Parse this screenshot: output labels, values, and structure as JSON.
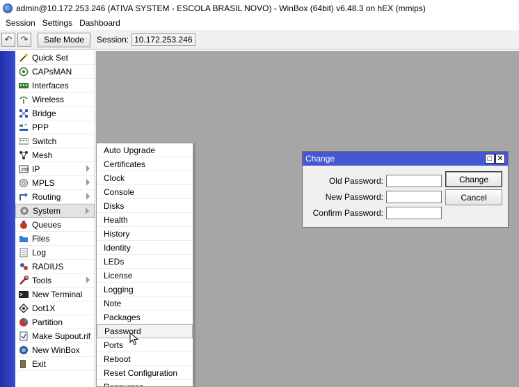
{
  "window": {
    "title": "admin@10.172.253.246 (ATIVA SYSTEM - ESCOLA BRASIL NOVO) - WinBox (64bit) v6.48.3 on hEX (mmips)"
  },
  "menubar": [
    "Session",
    "Settings",
    "Dashboard"
  ],
  "toolbar": {
    "undo_icon": "undo-icon",
    "redo_icon": "redo-icon",
    "safe_mode_label": "Safe Mode",
    "session_label": "Session:",
    "session_value": "10.172.253.246"
  },
  "sidebar": {
    "items": [
      {
        "label": "Quick Set",
        "icon": "wand-icon"
      },
      {
        "label": "CAPsMAN",
        "icon": "capsman-icon"
      },
      {
        "label": "Interfaces",
        "icon": "interfaces-icon"
      },
      {
        "label": "Wireless",
        "icon": "wireless-icon"
      },
      {
        "label": "Bridge",
        "icon": "bridge-icon"
      },
      {
        "label": "PPP",
        "icon": "ppp-icon"
      },
      {
        "label": "Switch",
        "icon": "switch-icon"
      },
      {
        "label": "Mesh",
        "icon": "mesh-icon"
      },
      {
        "label": "IP",
        "icon": "ip-icon"
      },
      {
        "label": "MPLS",
        "icon": "mpls-icon"
      },
      {
        "label": "Routing",
        "icon": "routing-icon"
      },
      {
        "label": "System",
        "icon": "gear-icon"
      },
      {
        "label": "Queues",
        "icon": "queues-icon"
      },
      {
        "label": "Files",
        "icon": "folder-icon"
      },
      {
        "label": "Log",
        "icon": "log-icon"
      },
      {
        "label": "RADIUS",
        "icon": "radius-icon"
      },
      {
        "label": "Tools",
        "icon": "tools-icon"
      },
      {
        "label": "New Terminal",
        "icon": "terminal-icon"
      },
      {
        "label": "Dot1X",
        "icon": "dot1x-icon"
      },
      {
        "label": "Partition",
        "icon": "partition-icon"
      },
      {
        "label": "Make Supout.rif",
        "icon": "supout-icon"
      },
      {
        "label": "New WinBox",
        "icon": "winbox-icon"
      },
      {
        "label": "Exit",
        "icon": "exit-icon"
      }
    ]
  },
  "submenu": {
    "items": [
      "Auto Upgrade",
      "Certificates",
      "Clock",
      "Console",
      "Disks",
      "Health",
      "History",
      "Identity",
      "LEDs",
      "License",
      "Logging",
      "Note",
      "Packages",
      "Password",
      "Ports",
      "Reboot",
      "Reset Configuration",
      "Resources"
    ]
  },
  "dialog": {
    "title": "Change",
    "old_password_label": "Old Password:",
    "new_password_label": "New Password:",
    "confirm_password_label": "Confirm Password:",
    "change_button": "Change",
    "cancel_button": "Cancel"
  },
  "colors": {
    "accent": "#4657d3",
    "sidebar_strip": "#2f41c2",
    "workspace": "#a6a6a6"
  }
}
